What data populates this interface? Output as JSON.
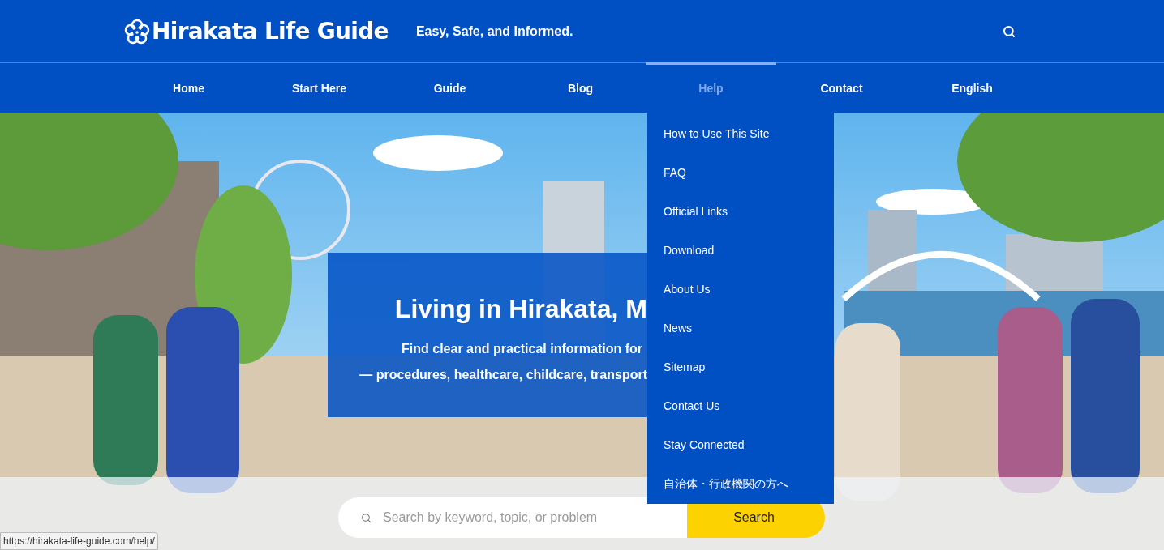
{
  "header": {
    "logo": "Hirakata Life Guide",
    "tagline": "Easy, Safe, and Informed."
  },
  "nav": [
    {
      "label": "Home",
      "selected": false
    },
    {
      "label": "Start Here",
      "selected": false
    },
    {
      "label": "Guide",
      "selected": false
    },
    {
      "label": "Blog",
      "selected": false
    },
    {
      "label": "Help",
      "selected": true
    },
    {
      "label": "Contact",
      "selected": false
    },
    {
      "label": "English",
      "selected": false
    }
  ],
  "dropdown": [
    "How to Use This Site",
    "FAQ",
    "Official Links",
    "Download",
    "About Us",
    "News",
    "Sitemap",
    "Contact Us",
    "Stay Connected",
    "自治体・行政機関の方へ"
  ],
  "hero": {
    "kind": "picture",
    "title": "Living in Hirakata, M",
    "lines": [
      "Find clear and practical information for",
      "— procedures, healthcare, childcare, transport"
    ]
  },
  "search": {
    "placeholder": "Search by keyword, topic, or problem",
    "button": "Search"
  },
  "status_bar": "https://hirakata-life-guide.com/help/"
}
